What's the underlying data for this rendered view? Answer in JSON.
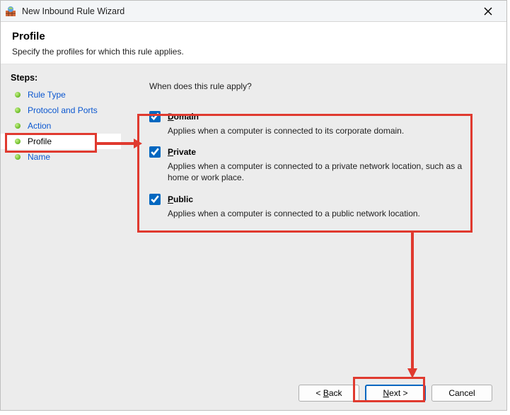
{
  "titlebar": {
    "title": "New Inbound Rule Wizard"
  },
  "header": {
    "title": "Profile",
    "subtitle": "Specify the profiles for which this rule applies."
  },
  "sidebar": {
    "heading": "Steps:",
    "items": [
      {
        "label": "Rule Type",
        "link": true,
        "current": false
      },
      {
        "label": "Protocol and Ports",
        "link": true,
        "current": false
      },
      {
        "label": "Action",
        "link": true,
        "current": false
      },
      {
        "label": "Profile",
        "link": false,
        "current": true
      },
      {
        "label": "Name",
        "link": true,
        "current": false
      }
    ]
  },
  "main": {
    "prompt": "When does this rule apply?",
    "options": [
      {
        "checked": true,
        "mnemonic": "D",
        "rest": "omain",
        "desc": "Applies when a computer is connected to its corporate domain."
      },
      {
        "checked": true,
        "mnemonic": "P",
        "rest": "rivate",
        "desc": "Applies when a computer is connected to a private network location, such as a home or work place."
      },
      {
        "checked": true,
        "mnemonic": "P",
        "rest": "ublic",
        "desc": "Applies when a computer is connected to a public network location."
      }
    ]
  },
  "footer": {
    "back_m": "B",
    "back_rest": "ack",
    "next_m": "N",
    "next_rest": "ext >",
    "cancel": "Cancel"
  }
}
